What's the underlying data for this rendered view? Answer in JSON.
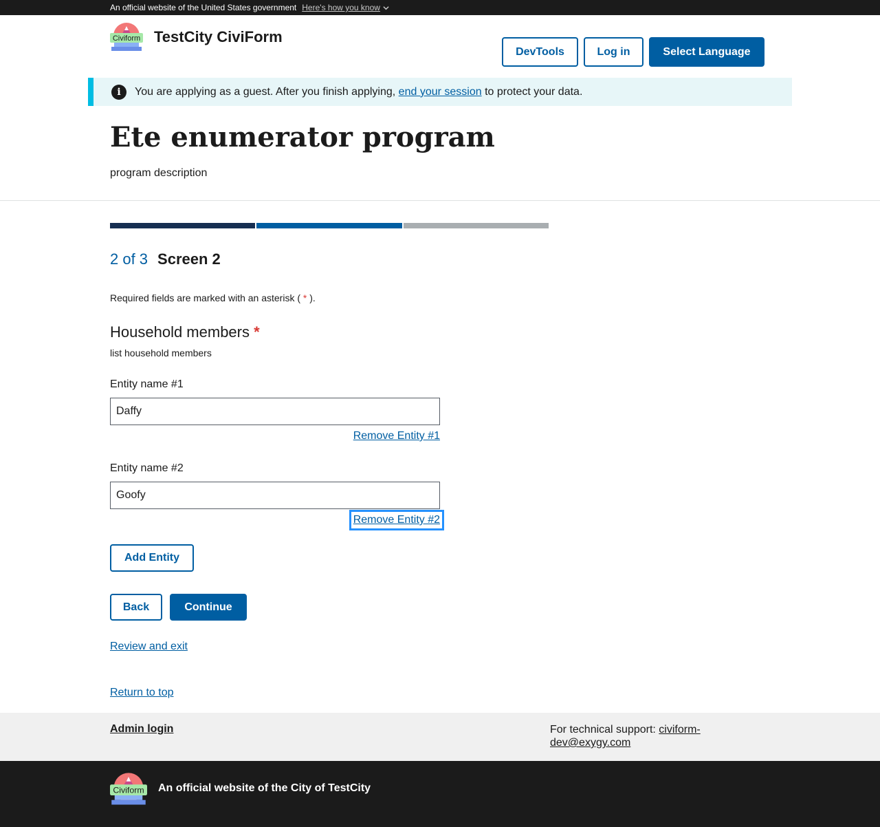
{
  "gov_banner": {
    "text": "An official website of the United States government",
    "link": "Here's how you know"
  },
  "header": {
    "logo_text": "Civiform",
    "site_title": "TestCity CiviForm",
    "devtools_label": "DevTools",
    "login_label": "Log in",
    "language_label": "Select Language"
  },
  "alert": {
    "text_before": "You are applying as a guest. After you finish applying, ",
    "link": "end your session",
    "text_after": " to protect your data."
  },
  "program": {
    "title": "Ete enumerator program",
    "description": "program description"
  },
  "progress": {
    "current": 2,
    "total": 3,
    "step_count": "2 of 3",
    "screen_title": "Screen 2"
  },
  "form": {
    "required_note_before": "Required fields are marked with an asterisk ( ",
    "required_note_asterisk": "*",
    "required_note_after": " ).",
    "question_title": "Household members",
    "question_asterisk": "*",
    "question_help": "list household members",
    "entities": [
      {
        "label": "Entity name #1",
        "value": "Daffy",
        "remove_label": "Remove Entity #1"
      },
      {
        "label": "Entity name #2",
        "value": "Goofy",
        "remove_label": "Remove Entity #2"
      }
    ],
    "add_label": "Add Entity",
    "back_label": "Back",
    "continue_label": "Continue",
    "review_label": "Review and exit",
    "return_top_label": "Return to top"
  },
  "footer": {
    "admin_login": "Admin login",
    "support_text": "For technical support: ",
    "support_email": "civiform-dev@exygy.com",
    "logo_text": "Civiform",
    "official_text": "An official website of the City of TestCity"
  },
  "colors": {
    "primary": "#005ea2",
    "dark": "#1b1b1b",
    "alert_bg": "#e7f6f8",
    "alert_border": "#00bde3",
    "required": "#d83933",
    "focus": "#2491ff"
  }
}
